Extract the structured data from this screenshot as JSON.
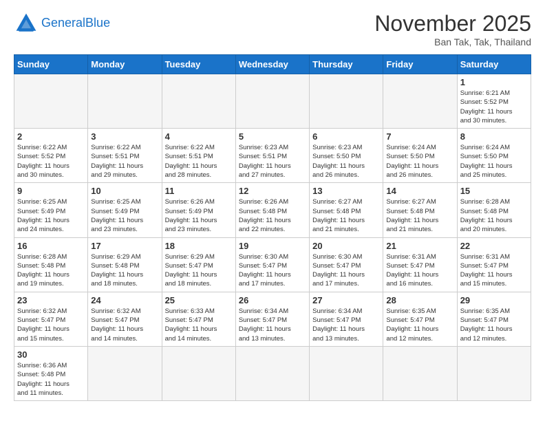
{
  "header": {
    "logo_general": "General",
    "logo_blue": "Blue",
    "month_title": "November 2025",
    "location": "Ban Tak, Tak, Thailand"
  },
  "days_of_week": [
    "Sunday",
    "Monday",
    "Tuesday",
    "Wednesday",
    "Thursday",
    "Friday",
    "Saturday"
  ],
  "weeks": [
    [
      {
        "day": "",
        "info": ""
      },
      {
        "day": "",
        "info": ""
      },
      {
        "day": "",
        "info": ""
      },
      {
        "day": "",
        "info": ""
      },
      {
        "day": "",
        "info": ""
      },
      {
        "day": "",
        "info": ""
      },
      {
        "day": "1",
        "info": "Sunrise: 6:21 AM\nSunset: 5:52 PM\nDaylight: 11 hours and 30 minutes."
      }
    ],
    [
      {
        "day": "2",
        "info": "Sunrise: 6:22 AM\nSunset: 5:52 PM\nDaylight: 11 hours and 30 minutes."
      },
      {
        "day": "3",
        "info": "Sunrise: 6:22 AM\nSunset: 5:51 PM\nDaylight: 11 hours and 29 minutes."
      },
      {
        "day": "4",
        "info": "Sunrise: 6:22 AM\nSunset: 5:51 PM\nDaylight: 11 hours and 28 minutes."
      },
      {
        "day": "5",
        "info": "Sunrise: 6:23 AM\nSunset: 5:51 PM\nDaylight: 11 hours and 27 minutes."
      },
      {
        "day": "6",
        "info": "Sunrise: 6:23 AM\nSunset: 5:50 PM\nDaylight: 11 hours and 26 minutes."
      },
      {
        "day": "7",
        "info": "Sunrise: 6:24 AM\nSunset: 5:50 PM\nDaylight: 11 hours and 26 minutes."
      },
      {
        "day": "8",
        "info": "Sunrise: 6:24 AM\nSunset: 5:50 PM\nDaylight: 11 hours and 25 minutes."
      }
    ],
    [
      {
        "day": "9",
        "info": "Sunrise: 6:25 AM\nSunset: 5:49 PM\nDaylight: 11 hours and 24 minutes."
      },
      {
        "day": "10",
        "info": "Sunrise: 6:25 AM\nSunset: 5:49 PM\nDaylight: 11 hours and 23 minutes."
      },
      {
        "day": "11",
        "info": "Sunrise: 6:26 AM\nSunset: 5:49 PM\nDaylight: 11 hours and 23 minutes."
      },
      {
        "day": "12",
        "info": "Sunrise: 6:26 AM\nSunset: 5:48 PM\nDaylight: 11 hours and 22 minutes."
      },
      {
        "day": "13",
        "info": "Sunrise: 6:27 AM\nSunset: 5:48 PM\nDaylight: 11 hours and 21 minutes."
      },
      {
        "day": "14",
        "info": "Sunrise: 6:27 AM\nSunset: 5:48 PM\nDaylight: 11 hours and 21 minutes."
      },
      {
        "day": "15",
        "info": "Sunrise: 6:28 AM\nSunset: 5:48 PM\nDaylight: 11 hours and 20 minutes."
      }
    ],
    [
      {
        "day": "16",
        "info": "Sunrise: 6:28 AM\nSunset: 5:48 PM\nDaylight: 11 hours and 19 minutes."
      },
      {
        "day": "17",
        "info": "Sunrise: 6:29 AM\nSunset: 5:48 PM\nDaylight: 11 hours and 18 minutes."
      },
      {
        "day": "18",
        "info": "Sunrise: 6:29 AM\nSunset: 5:47 PM\nDaylight: 11 hours and 18 minutes."
      },
      {
        "day": "19",
        "info": "Sunrise: 6:30 AM\nSunset: 5:47 PM\nDaylight: 11 hours and 17 minutes."
      },
      {
        "day": "20",
        "info": "Sunrise: 6:30 AM\nSunset: 5:47 PM\nDaylight: 11 hours and 17 minutes."
      },
      {
        "day": "21",
        "info": "Sunrise: 6:31 AM\nSunset: 5:47 PM\nDaylight: 11 hours and 16 minutes."
      },
      {
        "day": "22",
        "info": "Sunrise: 6:31 AM\nSunset: 5:47 PM\nDaylight: 11 hours and 15 minutes."
      }
    ],
    [
      {
        "day": "23",
        "info": "Sunrise: 6:32 AM\nSunset: 5:47 PM\nDaylight: 11 hours and 15 minutes."
      },
      {
        "day": "24",
        "info": "Sunrise: 6:32 AM\nSunset: 5:47 PM\nDaylight: 11 hours and 14 minutes."
      },
      {
        "day": "25",
        "info": "Sunrise: 6:33 AM\nSunset: 5:47 PM\nDaylight: 11 hours and 14 minutes."
      },
      {
        "day": "26",
        "info": "Sunrise: 6:34 AM\nSunset: 5:47 PM\nDaylight: 11 hours and 13 minutes."
      },
      {
        "day": "27",
        "info": "Sunrise: 6:34 AM\nSunset: 5:47 PM\nDaylight: 11 hours and 13 minutes."
      },
      {
        "day": "28",
        "info": "Sunrise: 6:35 AM\nSunset: 5:47 PM\nDaylight: 11 hours and 12 minutes."
      },
      {
        "day": "29",
        "info": "Sunrise: 6:35 AM\nSunset: 5:47 PM\nDaylight: 11 hours and 12 minutes."
      }
    ],
    [
      {
        "day": "30",
        "info": "Sunrise: 6:36 AM\nSunset: 5:48 PM\nDaylight: 11 hours and 11 minutes."
      },
      {
        "day": "",
        "info": ""
      },
      {
        "day": "",
        "info": ""
      },
      {
        "day": "",
        "info": ""
      },
      {
        "day": "",
        "info": ""
      },
      {
        "day": "",
        "info": ""
      },
      {
        "day": "",
        "info": ""
      }
    ]
  ]
}
